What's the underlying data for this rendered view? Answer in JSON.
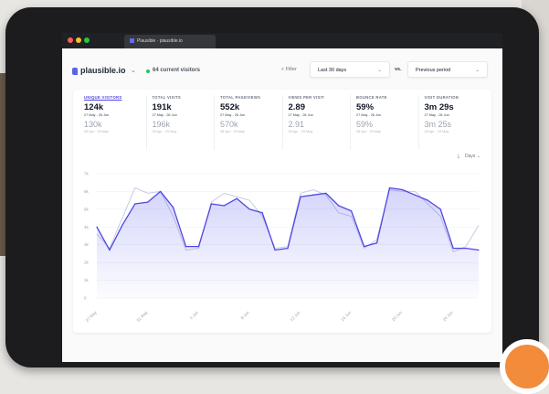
{
  "browser": {
    "tab_title": "Plausible · plausible.io",
    "traffic_lights": [
      "#ff5f57",
      "#febc2e",
      "#28c840"
    ]
  },
  "header": {
    "site_name": "plausible.io",
    "live_visitors": "64 current visitors",
    "filter_label": "Filter",
    "period_label": "Last 30 days",
    "vs_label": "vs.",
    "compare_label": "Previous period"
  },
  "metrics": [
    {
      "label": "UNIQUE VISITORS",
      "value": "124k",
      "range": "27 May - 26 Jun",
      "prev_value": "130k",
      "prev_range": "28 Apr - 29 May",
      "active": true
    },
    {
      "label": "TOTAL VISITS",
      "value": "191k",
      "range": "27 May - 26 Jun",
      "prev_value": "196k",
      "prev_range": "28 Apr - 29 May"
    },
    {
      "label": "TOTAL PAGEVIEWS",
      "value": "552k",
      "range": "27 May - 26 Jun",
      "prev_value": "570k",
      "prev_range": "28 Apr - 29 May"
    },
    {
      "label": "VIEWS PER VISIT",
      "value": "2.89",
      "range": "27 May - 26 Jun",
      "prev_value": "2.91",
      "prev_range": "28 Apr - 29 May"
    },
    {
      "label": "BOUNCE RATE",
      "value": "59%",
      "range": "27 May - 26 Jun",
      "prev_value": "59%",
      "prev_range": "28 Apr - 29 May"
    },
    {
      "label": "VISIT DURATION",
      "value": "3m 29s",
      "range": "27 May - 26 Jun",
      "prev_value": "3m 25s",
      "prev_range": "28 Apr - 29 May"
    }
  ],
  "interval_label": "Days",
  "chart_data": {
    "type": "line",
    "ylim": [
      0,
      7000
    ],
    "y_ticks": [
      "0",
      "1k",
      "2k",
      "3k",
      "4k",
      "5k",
      "6k",
      "7k"
    ],
    "x_ticks": [
      "27 May",
      "31 May",
      "4 Jun",
      "8 Jun",
      "12 Jun",
      "16 Jun",
      "20 Jun",
      "24 Jun"
    ],
    "series": [
      {
        "values": [
          4000,
          2700,
          4100,
          5300,
          5400,
          6000,
          5100,
          2900,
          2900,
          5300,
          5200,
          5600,
          5000,
          4800,
          2700,
          2800,
          5700,
          5800,
          5900,
          5200,
          4900,
          2900,
          3100,
          6200,
          6100,
          5800,
          5500,
          5000,
          2800,
          2800,
          2700
        ],
        "color": "#4f46e5"
      },
      {
        "values": [
          3600,
          2800,
          4500,
          6200,
          5900,
          6000,
          4600,
          2700,
          2800,
          5400,
          5900,
          5700,
          5500,
          4600,
          2800,
          2900,
          5900,
          6100,
          5800,
          4800,
          4600,
          2800,
          3300,
          6100,
          6000,
          6000,
          5300,
          4600,
          2600,
          2900,
          4100
        ],
        "color": "#c7cbe3"
      }
    ]
  }
}
